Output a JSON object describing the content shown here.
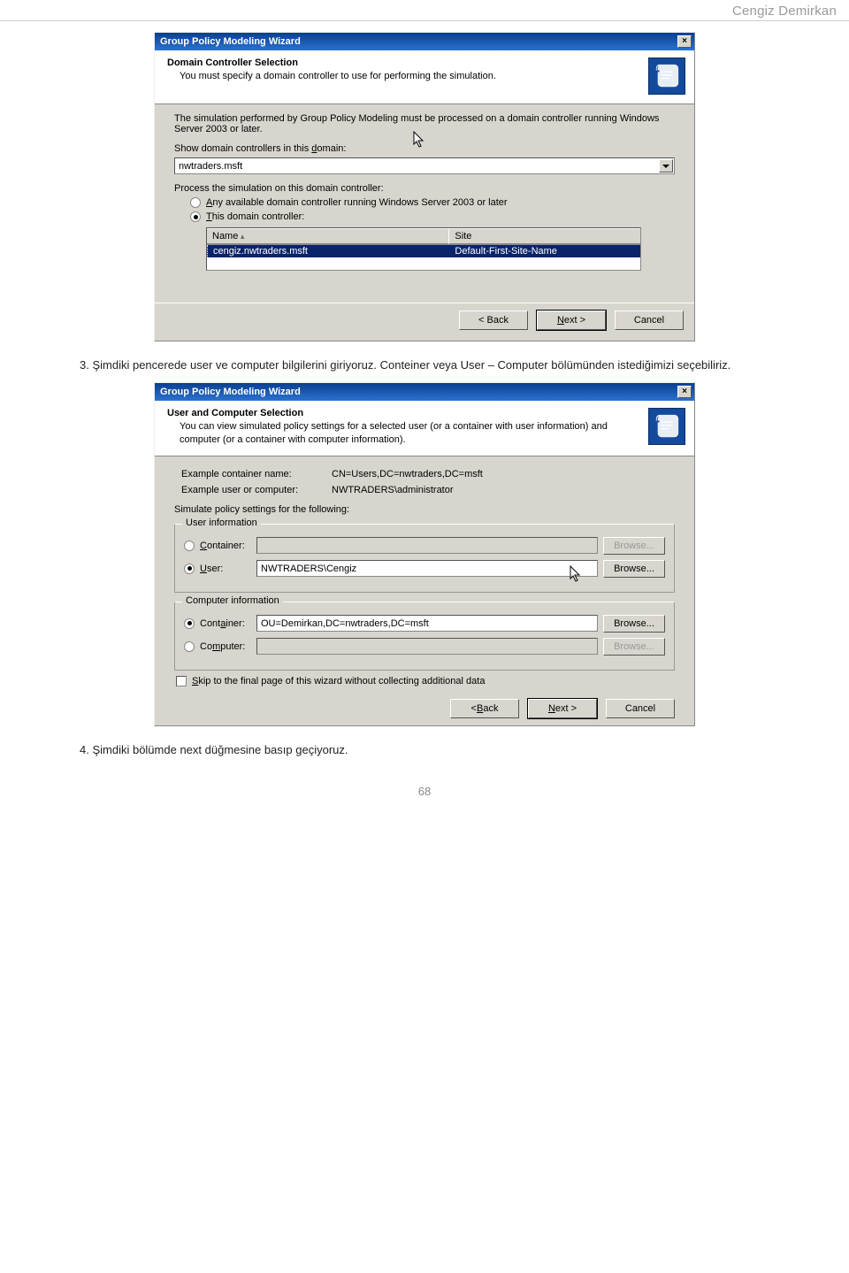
{
  "page": {
    "header": "Cengiz Demirkan",
    "text_step3": "3. Şimdiki pencerede user ve computer bilgilerini giriyoruz. Conteiner veya User – Computer bölümünden istediğimizi seçebiliriz.",
    "text_step4": "4. Şimdiki bölümde next düğmesine basıp geçiyoruz.",
    "page_number": "68"
  },
  "dialog1": {
    "window_title": "Group Policy Modeling Wizard",
    "head_title": "Domain Controller Selection",
    "head_sub": "You must specify a domain controller to use for performing the simulation.",
    "body_intro": "The simulation performed by Group Policy Modeling must be processed on a domain controller running Windows Server 2003 or later.",
    "show_in_label_pre": "Show domain controllers in this ",
    "show_in_label_u": "d",
    "show_in_label_post": "omain:",
    "domain_value": "nwtraders.msft",
    "process_label": "Process the simulation on this domain controller:",
    "radio_any_u": "A",
    "radio_any_post": "ny available domain controller running Windows Server 2003 or later",
    "radio_this_u": "T",
    "radio_this_post": "his domain controller:",
    "col_name": "Name",
    "col_site": "Site",
    "row_name": "cengiz.nwtraders.msft",
    "row_site": "Default-First-Site-Name",
    "btn_back": "< Back",
    "btn_next": "Next >",
    "btn_cancel": "Cancel"
  },
  "dialog2": {
    "window_title": "Group Policy Modeling Wizard",
    "head_title": "User and Computer Selection",
    "head_sub": "You can view simulated policy settings for a selected user (or a container with user information) and computer (or a container with computer information).",
    "ex_container_label": "Example container name:",
    "ex_container_value": "CN=Users,DC=nwtraders,DC=msft",
    "ex_user_label": "Example user or computer:",
    "ex_user_value": "NWTRADERS\\administrator",
    "simulate_label": "Simulate policy settings for the following:",
    "group_user_title": "User information",
    "user_container_label_u": "C",
    "user_container_label_post": "ontainer:",
    "user_user_label_u": "U",
    "user_user_label_post": "ser:",
    "user_value": "NWTRADERS\\Cengiz",
    "group_comp_title": "Computer information",
    "comp_container_label_pre": "Cont",
    "comp_container_label_u": "a",
    "comp_container_label_post": "iner:",
    "comp_container_value": "OU=Demirkan,DC=nwtraders,DC=msft",
    "comp_computer_label_pre": "Co",
    "comp_computer_label_u": "m",
    "comp_computer_label_post": "puter:",
    "browse": "Browse...",
    "skip_label_u": "S",
    "skip_label_post": "kip to the final page of this wizard without collecting additional data",
    "btn_back": "< Back",
    "btn_next": "Next >",
    "btn_cancel": "Cancel"
  }
}
